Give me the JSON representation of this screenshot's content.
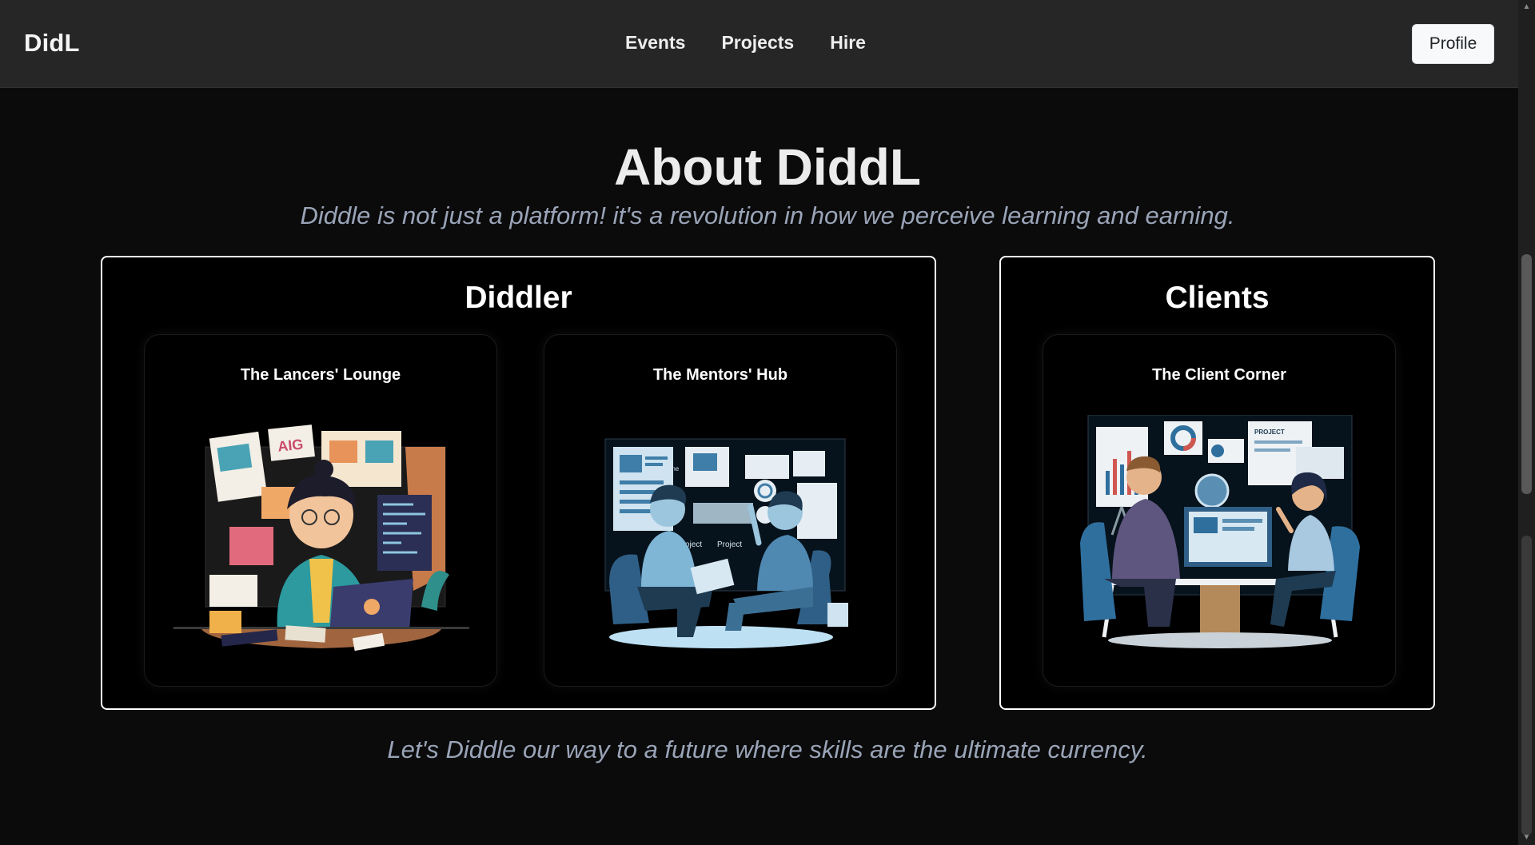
{
  "navbar": {
    "brand": "DidL",
    "links": [
      "Events",
      "Projects",
      "Hire"
    ],
    "profile_label": "Profile"
  },
  "about": {
    "title": "About DiddL",
    "subtitle": "Diddle is not just a platform! it's a revolution in how we perceive learning and earning.",
    "footer": "Let's Diddle our way to a future where skills are the ultimate currency."
  },
  "sections": {
    "diddler": {
      "title": "Diddler",
      "cards": [
        {
          "title": "The Lancers' Lounge",
          "illustration": "freelancer-at-laptop"
        },
        {
          "title": "The Mentors' Hub",
          "illustration": "mentor-meeting"
        }
      ]
    },
    "clients": {
      "title": "Clients",
      "cards": [
        {
          "title": "The Client Corner",
          "illustration": "client-meeting"
        }
      ]
    }
  },
  "colors": {
    "page_background": "#0b0b0b",
    "navbar_background": "#262626",
    "muted_text": "#9aa4b8",
    "accent_blue": "#5aa9d6",
    "accent_orange": "#e8935a"
  }
}
